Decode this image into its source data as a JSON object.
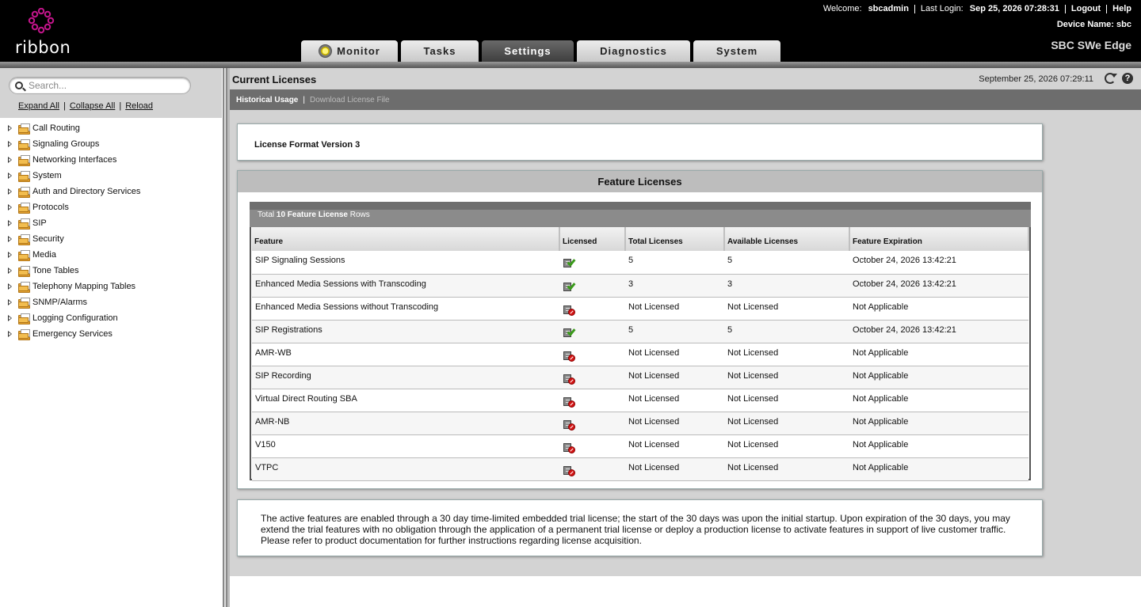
{
  "header": {
    "logo_text": "ribbon",
    "welcome_label": "Welcome:",
    "username": "sbcadmin",
    "last_login_label": "Last Login:",
    "last_login_value": "Sep 25, 2026 07:28:31",
    "logout_label": "Logout",
    "help_label": "Help",
    "device_label": "Device Name:",
    "device_value": "sbc",
    "product_name": "SBC SWe Edge"
  },
  "tabs": [
    {
      "label": "Monitor",
      "active": false
    },
    {
      "label": "Tasks",
      "active": false
    },
    {
      "label": "Settings",
      "active": true
    },
    {
      "label": "Diagnostics",
      "active": false
    },
    {
      "label": "System",
      "active": false
    }
  ],
  "sidebar": {
    "search_placeholder": "Search...",
    "expand_all": "Expand All",
    "collapse_all": "Collapse All",
    "reload": "Reload",
    "items": [
      {
        "label": "Call Routing"
      },
      {
        "label": "Signaling Groups"
      },
      {
        "label": "Networking Interfaces"
      },
      {
        "label": "System"
      },
      {
        "label": "Auth and Directory Services"
      },
      {
        "label": "Protocols"
      },
      {
        "label": "SIP"
      },
      {
        "label": "Security"
      },
      {
        "label": "Media"
      },
      {
        "label": "Tone Tables"
      },
      {
        "label": "Telephony Mapping Tables"
      },
      {
        "label": "SNMP/Alarms"
      },
      {
        "label": "Logging Configuration"
      },
      {
        "label": "Emergency Services"
      }
    ]
  },
  "page": {
    "title": "Current Licenses",
    "timestamp": "September 25, 2026 07:29:11",
    "historical_usage": "Historical Usage",
    "download_license": "Download License File",
    "license_format": "License Format Version 3",
    "features_title": "Feature Licenses",
    "caption_prefix": "Total",
    "caption_count": "10 Feature License",
    "caption_suffix": "Rows",
    "note": "The active features are enabled through a 30 day time-limited embedded trial license; the start of the 30 days was upon the initial startup. Upon expiration of the 30 days, you may extend the trial features with no obligation through the application of a permanent trial license or deploy a production license to activate features in support of live customer traffic. Please refer to product documentation for further instructions regarding license acquisition."
  },
  "table": {
    "columns": [
      "Feature",
      "Licensed",
      "Total Licenses",
      "Available Licenses",
      "Feature Expiration"
    ],
    "rows": [
      {
        "feature": "SIP Signaling Sessions",
        "licensed": "licensed-check-icon",
        "total": "5",
        "available": "5",
        "expiration": "October 24, 2026 13:42:21"
      },
      {
        "feature": "Enhanced Media Sessions with Transcoding",
        "licensed": "licensed-check-icon",
        "total": "3",
        "available": "3",
        "expiration": "October 24, 2026 13:42:21"
      },
      {
        "feature": "Enhanced Media Sessions without Transcoding",
        "licensed": "not-licensed-icon",
        "total": "Not Licensed",
        "available": "Not Licensed",
        "expiration": "Not Applicable"
      },
      {
        "feature": "SIP Registrations",
        "licensed": "licensed-check-icon",
        "total": "5",
        "available": "5",
        "expiration": "October 24, 2026 13:42:21"
      },
      {
        "feature": "AMR-WB",
        "licensed": "not-licensed-icon",
        "total": "Not Licensed",
        "available": "Not Licensed",
        "expiration": "Not Applicable"
      },
      {
        "feature": "SIP Recording",
        "licensed": "not-licensed-icon",
        "total": "Not Licensed",
        "available": "Not Licensed",
        "expiration": "Not Applicable"
      },
      {
        "feature": "Virtual Direct Routing SBA",
        "licensed": "not-licensed-icon",
        "total": "Not Licensed",
        "available": "Not Licensed",
        "expiration": "Not Applicable"
      },
      {
        "feature": "AMR-NB",
        "licensed": "not-licensed-icon",
        "total": "Not Licensed",
        "available": "Not Licensed",
        "expiration": "Not Applicable"
      },
      {
        "feature": "V150",
        "licensed": "not-licensed-icon",
        "total": "Not Licensed",
        "available": "Not Licensed",
        "expiration": "Not Applicable"
      },
      {
        "feature": "VTPC",
        "licensed": "not-licensed-icon",
        "total": "Not Licensed",
        "available": "Not Licensed",
        "expiration": "Not Applicable"
      }
    ]
  },
  "colors": {
    "header_bg": "#000000",
    "logo_accent": "#c4158c",
    "active_tab": "#4a4a4a",
    "panel_bg": "#d3d3d3",
    "licensed_green": "#3a9a1a",
    "not_licensed_red": "#d31414"
  }
}
